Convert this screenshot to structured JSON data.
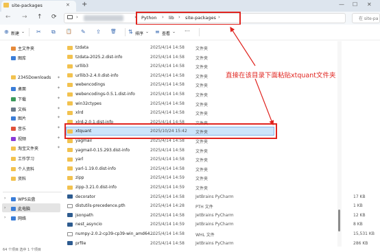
{
  "colors": {
    "annotation_red": "#e0231e",
    "folder_yellow": "#f2c24f",
    "selection_blue": "#cce5fb",
    "pycharm_file": "#2d5b8f"
  },
  "tab": {
    "label": "site-packages",
    "close": "×",
    "new_tab": "+"
  },
  "window_controls": {
    "minimize": "—",
    "maximize": "☐",
    "close": "✕"
  },
  "nav": {
    "back": "←",
    "forward": "→",
    "up": "↑",
    "refresh": "⟳"
  },
  "address": {
    "crumbs": [
      "Python",
      "lib",
      "site-packages"
    ],
    "separator": "›",
    "search_partial": "在 site-pa"
  },
  "toolbar": {
    "new_icon": "⊕",
    "new_label": "新建",
    "chevron": "⌄",
    "cut_icon": "✂",
    "copy_icon": "⧉",
    "paste_icon": "📋",
    "rename_icon": "✎",
    "share_icon": "⇪",
    "delete_icon": "🗑",
    "sort_icon": "⇅",
    "sort_label": "排序",
    "view_icon": "≡",
    "view_label": "查看",
    "more": "···"
  },
  "sidebar": {
    "items": [
      {
        "label": "主文件夹",
        "color": "#e58a3a"
      },
      {
        "label": "图库",
        "color": "#3a7dd8"
      },
      {
        "label": "2345Downloads",
        "color": "#f2c24f"
      },
      {
        "label": "桌面",
        "color": "#3a7dd8"
      },
      {
        "label": "下载",
        "color": "#3a9a5b"
      },
      {
        "label": "文档",
        "color": "#6b7b8c"
      },
      {
        "label": "图片",
        "color": "#3a7dd8"
      },
      {
        "label": "音乐",
        "color": "#e0523a"
      },
      {
        "label": "视频",
        "color": "#8a3ad8"
      },
      {
        "label": "淘宝文件夹",
        "color": "#f2c24f"
      },
      {
        "label": "工作学习",
        "color": "#f2c24f"
      },
      {
        "label": "个人资料",
        "color": "#f2c24f"
      },
      {
        "label": "资料",
        "color": "#f2c24f"
      }
    ],
    "pin": "✦",
    "tree": [
      {
        "label": "WPS云盘",
        "color": "#3a7dd8"
      },
      {
        "label": "此电脑",
        "color": "#3a7dd8"
      },
      {
        "label": "网络",
        "color": "#3a7dd8"
      }
    ],
    "expand": "›"
  },
  "files": [
    {
      "name": "tzdata",
      "date": "2025/4/14 14:58",
      "type": "文件夹",
      "size": "",
      "kind": "folder"
    },
    {
      "name": "tzdata-2025.2.dist-info",
      "date": "2025/4/14 14:58",
      "type": "文件夹",
      "size": "",
      "kind": "folder"
    },
    {
      "name": "urllib3",
      "date": "2025/4/14 14:58",
      "type": "文件夹",
      "size": "",
      "kind": "folder"
    },
    {
      "name": "urllib3-2.4.0.dist-info",
      "date": "2025/4/14 14:58",
      "type": "文件夹",
      "size": "",
      "kind": "folder"
    },
    {
      "name": "webencodings",
      "date": "2025/4/14 14:58",
      "type": "文件夹",
      "size": "",
      "kind": "folder"
    },
    {
      "name": "webencodings-0.5.1.dist-info",
      "date": "2025/4/14 14:58",
      "type": "文件夹",
      "size": "",
      "kind": "folder"
    },
    {
      "name": "win32ctypes",
      "date": "2025/4/14 14:58",
      "type": "文件夹",
      "size": "",
      "kind": "folder"
    },
    {
      "name": "xlrd",
      "date": "2025/4/14 14:58",
      "type": "文件夹",
      "size": "",
      "kind": "folder"
    },
    {
      "name": "xlrd-2.0.1.dist-info",
      "date": "2025/4/14 14:58",
      "type": "文件夹",
      "size": "",
      "kind": "folder"
    },
    {
      "name": "xtquant",
      "date": "2025/10/24 15:42",
      "type": "文件夹",
      "size": "",
      "kind": "folder"
    },
    {
      "name": "yagmail",
      "date": "2025/4/14 14:58",
      "type": "文件夹",
      "size": "",
      "kind": "folder"
    },
    {
      "name": "yagmail-0.15.293.dist-info",
      "date": "2025/4/14 14:58",
      "type": "文件夹",
      "size": "",
      "kind": "folder"
    },
    {
      "name": "yarl",
      "date": "2025/4/14 14:58",
      "type": "文件夹",
      "size": "",
      "kind": "folder"
    },
    {
      "name": "yarl-1.19.0.dist-info",
      "date": "2025/4/14 14:58",
      "type": "文件夹",
      "size": "",
      "kind": "folder"
    },
    {
      "name": "zipp",
      "date": "2025/4/14 14:59",
      "type": "文件夹",
      "size": "",
      "kind": "folder"
    },
    {
      "name": "zipp-3.21.0.dist-info",
      "date": "2025/4/14 14:59",
      "type": "文件夹",
      "size": "",
      "kind": "folder"
    },
    {
      "name": "decorator",
      "date": "2025/4/14 14:58",
      "type": "JetBrains PyCharm",
      "size": "17 KB",
      "kind": "py"
    },
    {
      "name": "distutils-precedence.pth",
      "date": "2025/4/14 14:28",
      "type": "PTH 文件",
      "size": "1 KB",
      "kind": "txt"
    },
    {
      "name": "jsonpath",
      "date": "2025/4/14 14:58",
      "type": "JetBrains PyCharm",
      "size": "12 KB",
      "kind": "py"
    },
    {
      "name": "nest_asyncio",
      "date": "2025/4/14 14:59",
      "type": "JetBrains PyCharm",
      "size": "8 KB",
      "kind": "py"
    },
    {
      "name": "numpy-2.0.2-cp39-cp39-win_amd64....",
      "date": "2025/4/14 14:58",
      "type": "WHL 文件",
      "size": "15,531 KB",
      "kind": "txt"
    },
    {
      "name": "prfile",
      "date": "2025/4/14 14:58",
      "type": "JetBrains PyCharm",
      "size": "286 KB",
      "kind": "py"
    }
  ],
  "annotation": {
    "text": "直接在该目录下面粘贴xtquant文件夹"
  },
  "status": {
    "text": "64 个项目  选中 1 个项目"
  }
}
